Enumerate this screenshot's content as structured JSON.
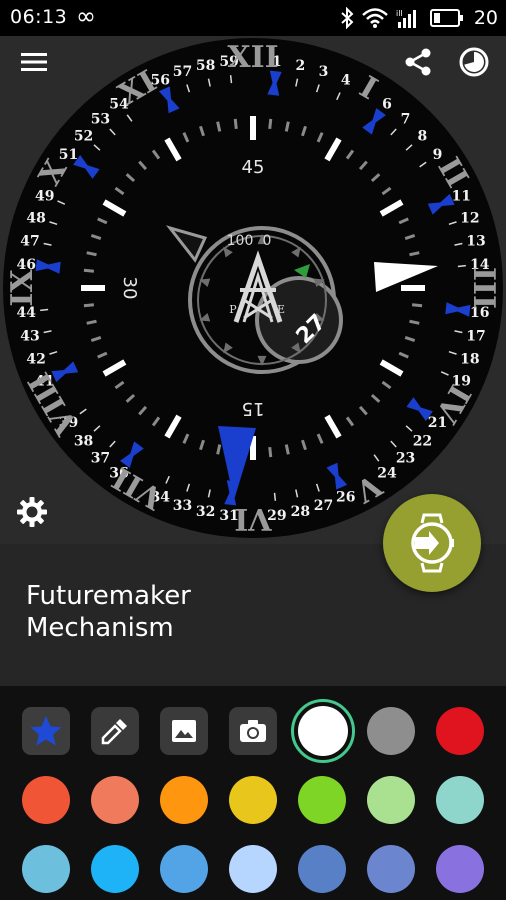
{
  "status_bar": {
    "time": "06:13",
    "infinity_glyph": "∞",
    "battery_level": "20",
    "icons": [
      "bluetooth-icon",
      "wifi-icon",
      "cell-signal-icon",
      "battery-icon"
    ]
  },
  "toolbar": {
    "menu_icon": "hamburger-menu-icon",
    "share_icon": "share-icon",
    "timer_icon": "clock-timer-icon"
  },
  "watch_face": {
    "roman_numerals": [
      "XII",
      "I",
      "II",
      "III",
      "IV",
      "V",
      "VI",
      "VII",
      "VIII",
      "IX",
      "X",
      "XI"
    ],
    "minute_numbers": [
      "59",
      "1",
      "2",
      "3",
      "4",
      "6",
      "7",
      "8",
      "9",
      "11",
      "12",
      "13",
      "14",
      "16",
      "17",
      "18",
      "19",
      "21",
      "22",
      "23",
      "24",
      "26",
      "27",
      "28",
      "29",
      "31",
      "32",
      "33",
      "34",
      "36",
      "37",
      "38",
      "39",
      "41",
      "42",
      "43",
      "44",
      "46",
      "47",
      "48",
      "49",
      "51",
      "52",
      "53",
      "54",
      "56",
      "57",
      "58"
    ],
    "inner_labels": [
      "45",
      "30",
      "15"
    ],
    "subdial_labels": [
      "100",
      "0"
    ],
    "logo_letters": [
      "P",
      "E"
    ],
    "date": "27",
    "colors": {
      "face": "#060606",
      "highlight": "#1a3fcf",
      "subdial_accent": "#2e9e3a"
    }
  },
  "settings_icon": "gear-icon",
  "watchface": {
    "name": "Futuremaker\nMechanism"
  },
  "apply_button": {
    "icon": "watch-sync-icon",
    "color": "#95a030"
  },
  "palette": {
    "tools": [
      {
        "name": "star-tool",
        "icon": "star-icon"
      },
      {
        "name": "color-picker-tool",
        "icon": "eyedropper-icon"
      },
      {
        "name": "image-tool",
        "icon": "image-icon"
      },
      {
        "name": "camera-tool",
        "icon": "camera-icon"
      }
    ],
    "selected_color": "#ffffff",
    "colors": [
      "#8e8e8e",
      "#e0141f",
      "#f05636",
      "#f07a5c",
      "#ff960f",
      "#e9c61c",
      "#7ed525",
      "#aae191",
      "#8ed6cb",
      "#6cc0de",
      "#1db3f6",
      "#52a4e7",
      "#b6d5ff",
      "#5880c6",
      "#6c85cf",
      "#8a71e0"
    ]
  }
}
